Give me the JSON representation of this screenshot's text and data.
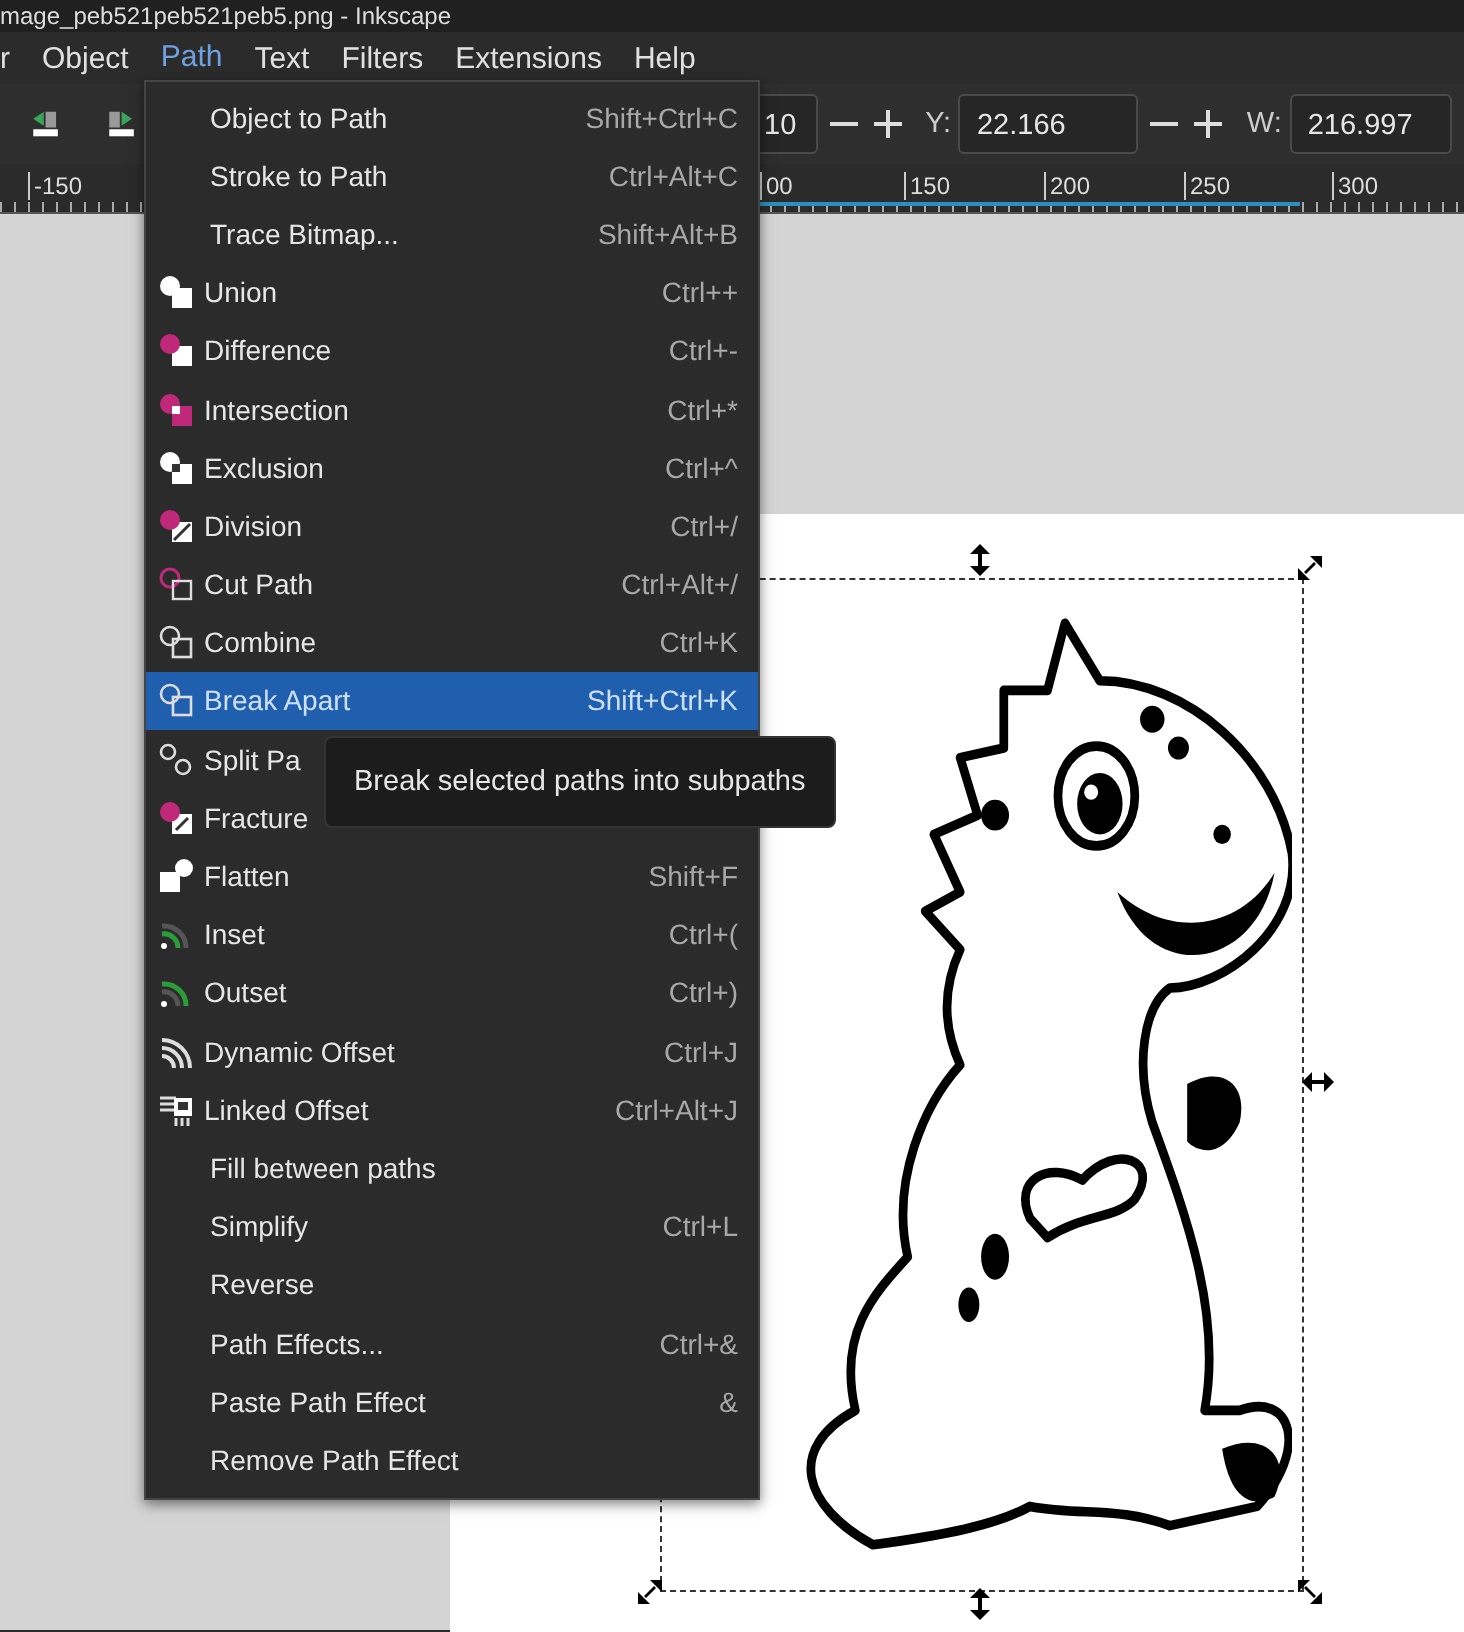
{
  "window": {
    "title": "mage_peb521peb521peb5.png - Inkscape"
  },
  "menu_bar": [
    {
      "label": "r",
      "selected": false
    },
    {
      "label": "Object",
      "selected": false
    },
    {
      "label": "Path",
      "selected": true
    },
    {
      "label": "Text",
      "selected": false
    },
    {
      "label": "Filters",
      "selected": false
    },
    {
      "label": "Extensions",
      "selected": false
    },
    {
      "label": "Help",
      "selected": false
    }
  ],
  "toolbar": {
    "x_field": {
      "value": "10"
    },
    "y_label": "Y:",
    "y_field": {
      "value": "22.166"
    },
    "w_label": "W:",
    "w_field": {
      "value": "216.997"
    }
  },
  "ruler": {
    "labels": [
      "-150",
      "00",
      "150",
      "200",
      "250",
      "300"
    ]
  },
  "path_menu": [
    {
      "label": "Object to Path",
      "shortcut": "Shift+Ctrl+C",
      "kind": "plain",
      "selected": false
    },
    {
      "label": "Stroke to Path",
      "shortcut": "Ctrl+Alt+C",
      "kind": "plain",
      "selected": false
    },
    {
      "label": "Trace Bitmap...",
      "shortcut": "Shift+Alt+B",
      "kind": "plain",
      "selected": false
    },
    {
      "label": "Union",
      "shortcut": "Ctrl++",
      "kind": "icon",
      "selected": false
    },
    {
      "label": "Difference",
      "shortcut": "Ctrl+-",
      "kind": "icon",
      "selected": false
    },
    {
      "label": "Intersection",
      "shortcut": "Ctrl+*",
      "kind": "icon",
      "selected": false
    },
    {
      "label": "Exclusion",
      "shortcut": "Ctrl+^",
      "kind": "icon",
      "selected": false
    },
    {
      "label": "Division",
      "shortcut": "Ctrl+/",
      "kind": "icon",
      "selected": false
    },
    {
      "label": "Cut Path",
      "shortcut": "Ctrl+Alt+/",
      "kind": "icon",
      "selected": false
    },
    {
      "label": "Combine",
      "shortcut": "Ctrl+K",
      "kind": "icon",
      "selected": false
    },
    {
      "label": "Break Apart",
      "shortcut": "Shift+Ctrl+K",
      "kind": "icon",
      "selected": true
    },
    {
      "label": "Split Pa",
      "kind": "icon",
      "selected": false
    },
    {
      "label": "Fracture",
      "kind": "icon",
      "selected": false
    },
    {
      "label": "Flatten",
      "shortcut": "Shift+F",
      "kind": "icon",
      "selected": false
    },
    {
      "label": "Inset",
      "shortcut": "Ctrl+(",
      "kind": "icon",
      "selected": false
    },
    {
      "label": "Outset",
      "shortcut": "Ctrl+)",
      "kind": "icon",
      "selected": false
    },
    {
      "label": "Dynamic Offset",
      "shortcut": "Ctrl+J",
      "kind": "icon",
      "selected": false
    },
    {
      "label": "Linked Offset",
      "shortcut": "Ctrl+Alt+J",
      "kind": "icon",
      "selected": false
    },
    {
      "label": "Fill between paths",
      "kind": "plain",
      "selected": false
    },
    {
      "label": "Simplify",
      "shortcut": "Ctrl+L",
      "kind": "plain",
      "selected": false
    },
    {
      "label": "Reverse",
      "kind": "plain",
      "selected": false
    },
    {
      "label": "Path Effects...",
      "shortcut": "Ctrl+&",
      "kind": "plain",
      "selected": false
    },
    {
      "label": "Paste Path Effect",
      "shortcut": "&",
      "kind": "plain",
      "selected": false
    },
    {
      "label": "Remove Path Effect",
      "kind": "plain",
      "selected": false
    }
  ],
  "tooltip": {
    "text": "Break selected paths into subpaths"
  }
}
